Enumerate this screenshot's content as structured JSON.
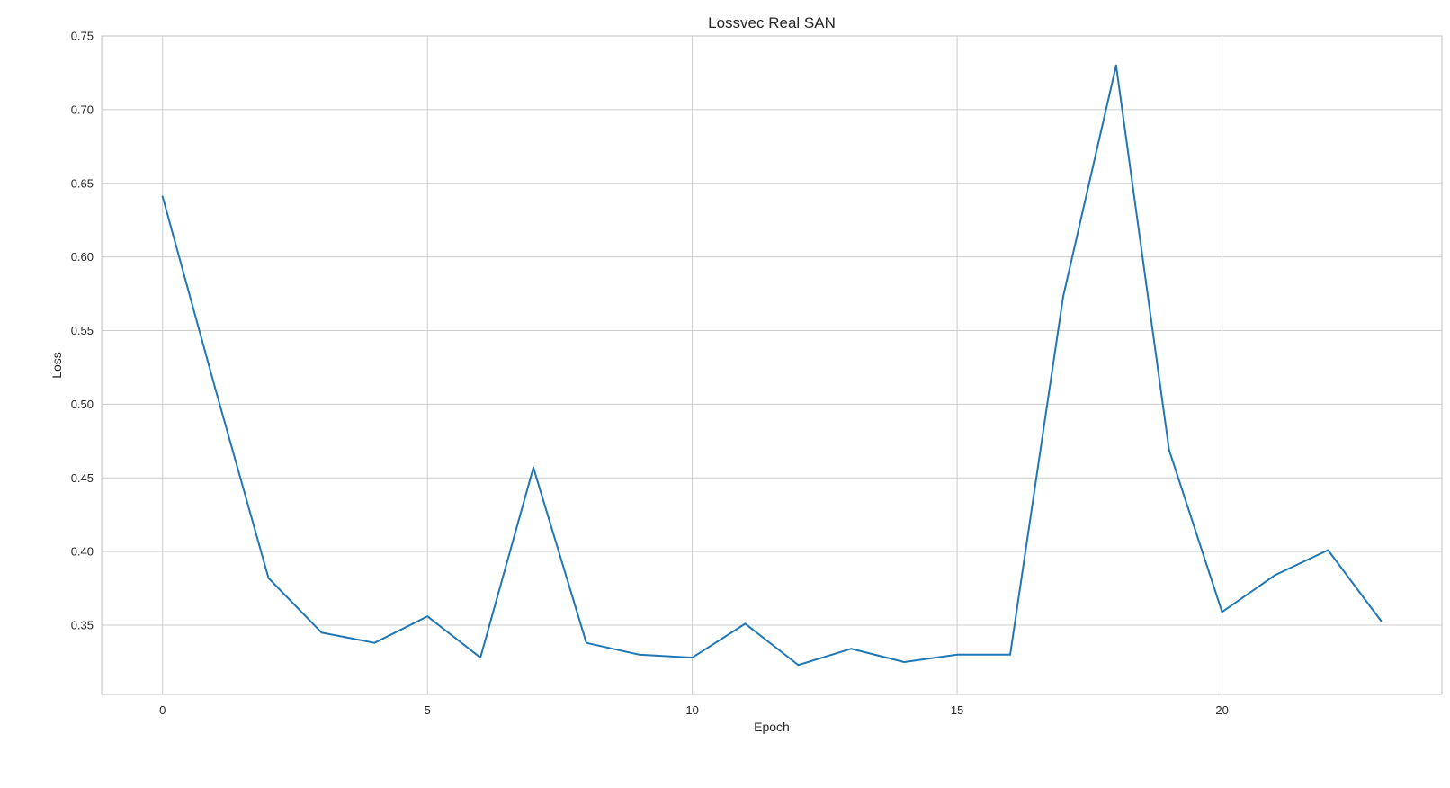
{
  "chart_data": {
    "type": "line",
    "title": "Lossvec Real SAN",
    "xlabel": "Epoch",
    "ylabel": "Loss",
    "xlim": [
      -1.15,
      24.15
    ],
    "ylim": [
      0.303,
      0.75
    ],
    "xticks": [
      0,
      5,
      10,
      15,
      20
    ],
    "xtick_labels": [
      "0",
      "5",
      "10",
      "15",
      "20"
    ],
    "yticks": [
      0.35,
      0.4,
      0.45,
      0.5,
      0.55,
      0.6,
      0.65,
      0.7,
      0.75
    ],
    "ytick_labels": [
      "0.35",
      "0.40",
      "0.45",
      "0.50",
      "0.55",
      "0.60",
      "0.65",
      "0.70",
      "0.75"
    ],
    "grid": true,
    "series": [
      {
        "color": "#1f77b4",
        "x": [
          0,
          1,
          2,
          3,
          4,
          5,
          6,
          7,
          8,
          9,
          10,
          11,
          12,
          13,
          14,
          15,
          16,
          17,
          18,
          19,
          20,
          21,
          22,
          23
        ],
        "y": [
          0.641,
          0.51,
          0.382,
          0.345,
          0.338,
          0.356,
          0.328,
          0.457,
          0.338,
          0.33,
          0.328,
          0.351,
          0.323,
          0.334,
          0.325,
          0.33,
          0.33,
          0.573,
          0.73,
          0.469,
          0.359,
          0.384,
          0.401,
          0.353
        ]
      }
    ]
  }
}
